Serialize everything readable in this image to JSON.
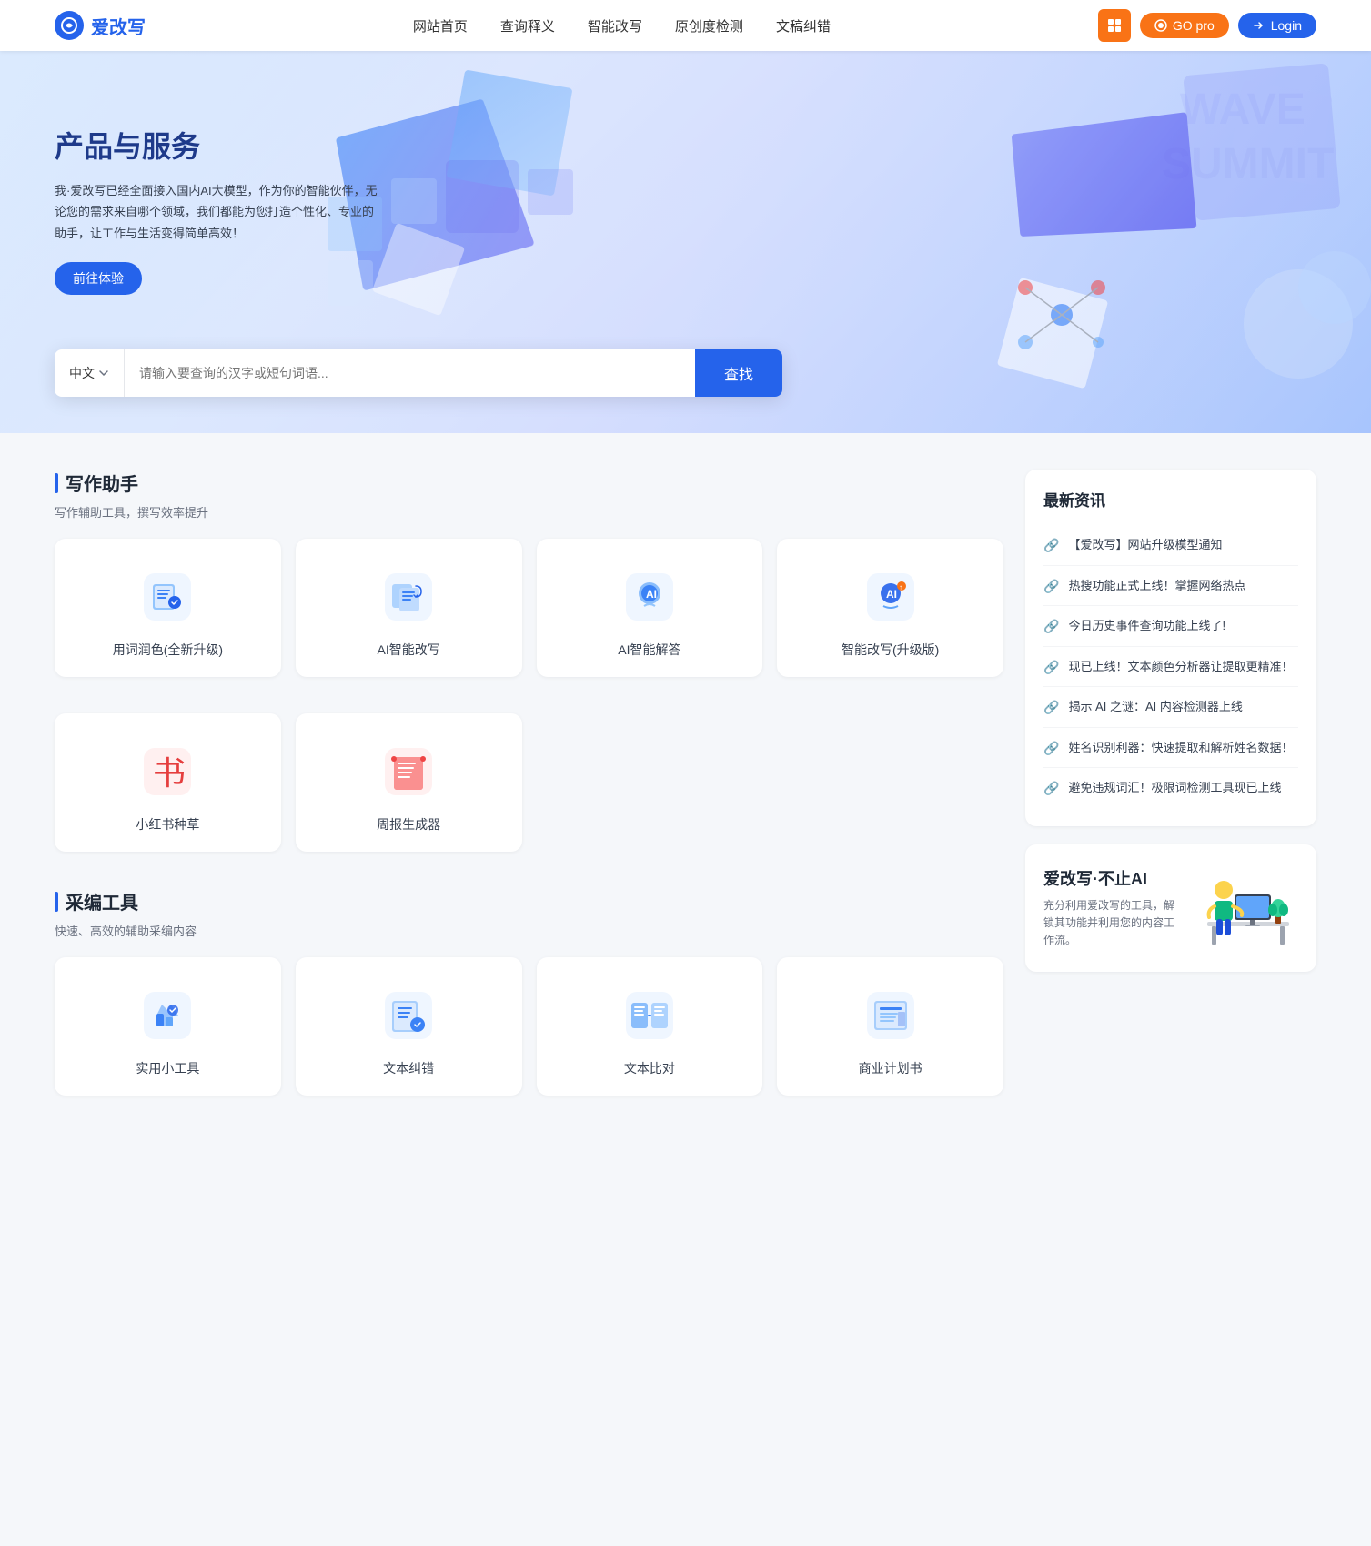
{
  "nav": {
    "logo_text": "爱改写",
    "links": [
      {
        "label": "网站首页",
        "id": "home"
      },
      {
        "label": "查询释义",
        "id": "query"
      },
      {
        "label": "智能改写",
        "id": "rewrite"
      },
      {
        "label": "原创度检测",
        "id": "originality"
      },
      {
        "label": "文稿纠错",
        "id": "proofread"
      }
    ],
    "btn_grid_icon": "⊞",
    "btn_go_pro": "GO pro",
    "btn_login": "Login"
  },
  "hero": {
    "title": "产品与服务",
    "desc": "我·爱改写已经全面接入国内AI大模型，作为你的智能伙伴，无论您的需求来自哪个领域，我们都能为您打造个性化、专业的助手，让工作与生活变得简单高效！",
    "btn_try": "前往体验"
  },
  "search": {
    "lang": "中文",
    "placeholder": "请输入要查询的汉字或短句词语...",
    "btn": "查找"
  },
  "writing_section": {
    "title": "写作助手",
    "desc": "写作辅助工具，撰写效率提升",
    "tools": [
      {
        "label": "用词润色(全新升级)",
        "icon_type": "writing_polish"
      },
      {
        "label": "AI智能改写",
        "icon_type": "ai_rewrite"
      },
      {
        "label": "AI智能解答",
        "icon_type": "ai_answer"
      },
      {
        "label": "智能改写(升级版)",
        "icon_type": "smart_rewrite_pro"
      },
      {
        "label": "小红书种草",
        "icon_type": "xiaohongshu"
      },
      {
        "label": "周报生成器",
        "icon_type": "weekly_report"
      }
    ]
  },
  "tools_section": {
    "title": "采编工具",
    "desc": "快速、高效的辅助采编内容",
    "tools": [
      {
        "label": "实用小工具",
        "icon_type": "utility"
      },
      {
        "label": "文本纠错",
        "icon_type": "text_correct"
      },
      {
        "label": "文本比对",
        "icon_type": "text_compare"
      },
      {
        "label": "商业计划书",
        "icon_type": "business_plan"
      }
    ]
  },
  "news": {
    "title": "最新资讯",
    "items": [
      {
        "text": "【爱改写】网站升级模型通知"
      },
      {
        "text": "热搜功能正式上线！掌握网络热点"
      },
      {
        "text": "今日历史事件查询功能上线了!"
      },
      {
        "text": "现已上线！文本颜色分析器让提取更精准！"
      },
      {
        "text": "揭示 AI 之谜：AI 内容检测器上线"
      },
      {
        "text": "姓名识别利器：快速提取和解析姓名数据！"
      },
      {
        "text": "避免违规词汇！极限词检测工具现已上线"
      }
    ]
  },
  "promo": {
    "title": "爱改写·不止AI",
    "desc": "充分利用爱改写的工具，解锁其功能并利用您的内容工作流。"
  }
}
